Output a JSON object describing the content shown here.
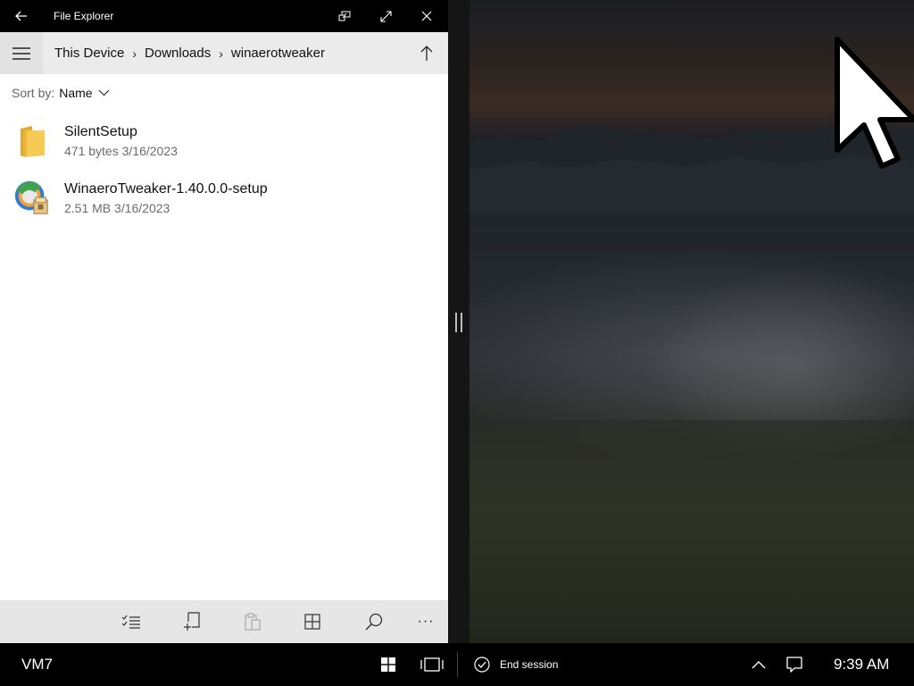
{
  "window": {
    "title": "File Explorer"
  },
  "breadcrumb": {
    "items": [
      "This Device",
      "Downloads",
      "winaerotweaker"
    ],
    "separator": "›"
  },
  "sort": {
    "label": "Sort by:",
    "value": "Name"
  },
  "files": [
    {
      "name": "SilentSetup",
      "size": "471 bytes",
      "date": "3/16/2023",
      "icon": "folder-icon"
    },
    {
      "name": "WinaeroTweaker-1.40.0.0-setup",
      "size": "2.51 MB",
      "date": "3/16/2023",
      "icon": "installer-icon"
    }
  ],
  "bottom_toolbar": {
    "icons": [
      "select-multiple-icon",
      "new-item-icon",
      "paste-icon",
      "view-grid-icon",
      "search-icon",
      "more-icon"
    ],
    "more_label": "···"
  },
  "taskbar": {
    "device_name": "VM7",
    "end_session_label": "End session",
    "time": "9:39 AM"
  },
  "colors": {
    "folder": "#F2C34B",
    "titlebar": "#000000",
    "commandbar": "#EBEBEB",
    "taskbar": "#000000"
  }
}
